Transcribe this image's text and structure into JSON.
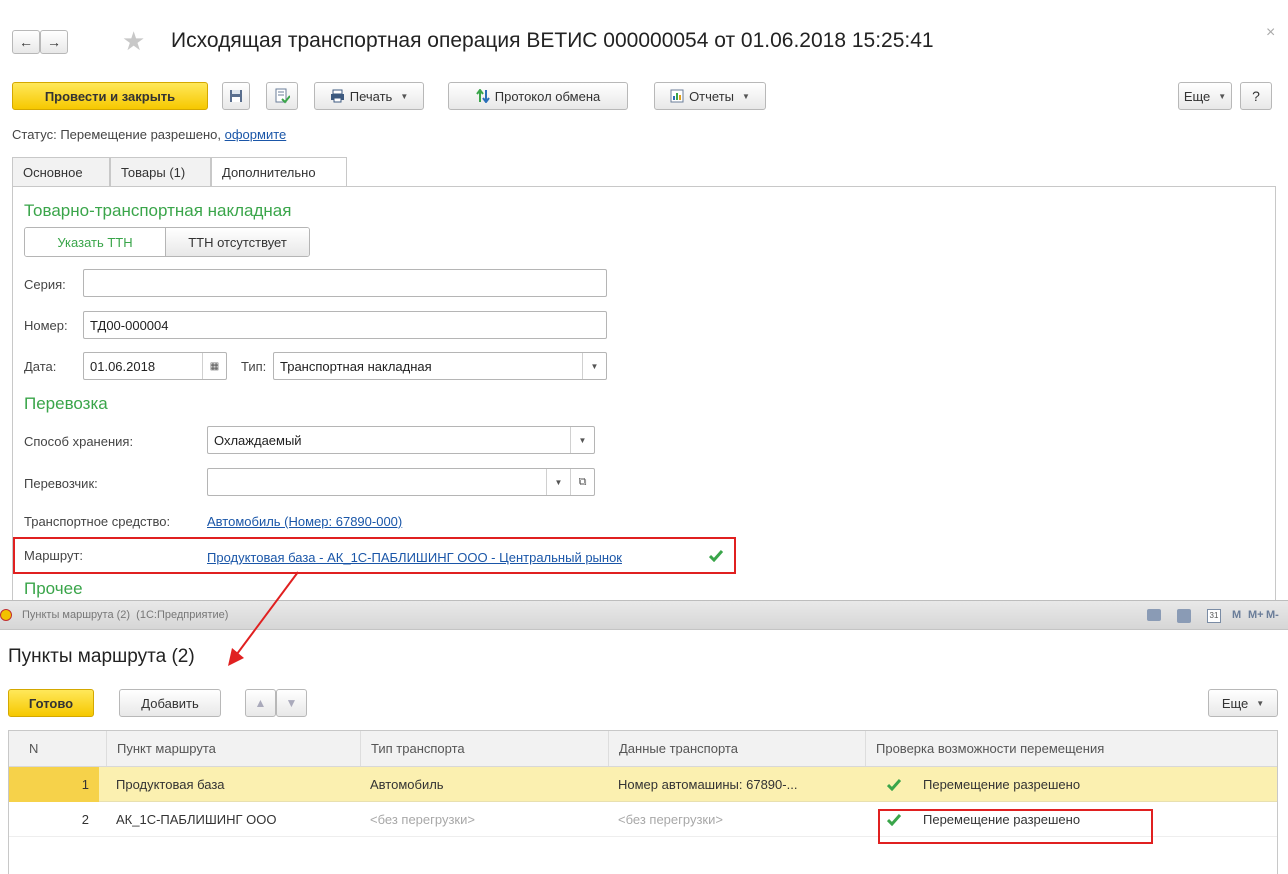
{
  "window": {
    "title": "Исходящая транспортная операция ВЕТИС 000000054 от 01.06.2018 15:25:41",
    "close": "×"
  },
  "toolbar": {
    "post_close": "Провести и закрыть",
    "print": "Печать",
    "exchange_protocol": "Протокол обмена",
    "reports": "Отчеты",
    "more": "Еще",
    "help": "?"
  },
  "status": {
    "prefix": "Статус: Перемещение разрешено,",
    "link": "оформите"
  },
  "tabs": [
    "Основное",
    "Товары (1)",
    "Дополнительно"
  ],
  "ttn": {
    "section": "Товарно-транспортная накладная",
    "toggle_specify": "Указать ТТН",
    "toggle_absent": "ТТН отсутствует",
    "series_label": "Серия:",
    "series_value": "",
    "number_label": "Номер:",
    "number_value": "ТД00-000004",
    "date_label": "Дата:",
    "date_value": "01.06.2018",
    "type_label": "Тип:",
    "type_value": "Транспортная накладная"
  },
  "transport": {
    "section": "Перевозка",
    "storage_label": "Способ хранения:",
    "storage_value": "Охлаждаемый",
    "carrier_label": "Перевозчик:",
    "carrier_value": "",
    "vehicle_label": "Транспортное средство:",
    "vehicle_value": "Автомобиль (Номер: 67890-000)",
    "route_label": "Маршрут:",
    "route_value": "Продуктовая база - АК_1С-ПАБЛИШИНГ ООО - Центральный рынок"
  },
  "other": {
    "section": "Прочее"
  },
  "subwindow": {
    "titlebar": "Пункты маршрута (2)  (1С:Предприятие)",
    "title": "Пункты маршрута (2)",
    "ready": "Готово",
    "add": "Добавить",
    "more": "Еще",
    "tb_m": "M",
    "tb_mplus": "M+",
    "tb_mminus": "M-",
    "close": "✕"
  },
  "grid": {
    "columns": [
      "N",
      "Пункт маршрута",
      "Тип транспорта",
      "Данные транспорта",
      "Проверка возможности перемещения"
    ],
    "rows": [
      {
        "n": "1",
        "point": "Продуктовая база",
        "transport_type": "Автомобиль",
        "transport_data": "Номер автомашины: 67890-...",
        "check": "Перемещение разрешено"
      },
      {
        "n": "2",
        "point": "АК_1С-ПАБЛИШИНГ ООО",
        "transport_type": "<без перегрузки>",
        "transport_data": "<без перегрузки>",
        "check": "Перемещение разрешено"
      }
    ]
  },
  "colors": {
    "accent_green": "#3aa54a",
    "highlight_row": "#fbf0b0",
    "annotation_red": "#e02020",
    "button_yellow": "#f6c800"
  }
}
